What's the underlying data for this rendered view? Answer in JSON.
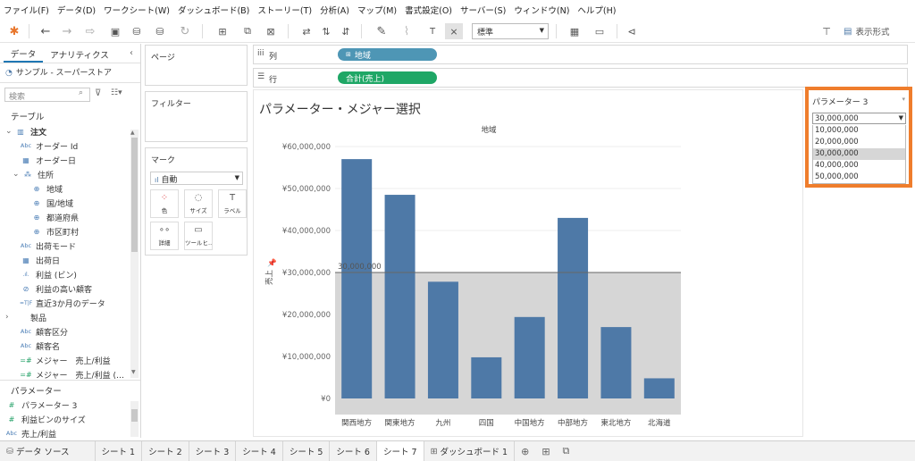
{
  "menu": [
    "ファイル(F)",
    "データ(D)",
    "ワークシート(W)",
    "ダッシュボード(B)",
    "ストーリー(T)",
    "分析(A)",
    "マップ(M)",
    "書式設定(O)",
    "サーバー(S)",
    "ウィンドウ(N)",
    "ヘルプ(H)"
  ],
  "toolbar": {
    "fit_value": "標準",
    "show_me_label": "表示形式"
  },
  "leftpane": {
    "tabs": [
      "データ",
      "アナリティクス"
    ],
    "datasource": "サンプル - スーパーストア",
    "search_placeholder": "検索",
    "table_heading": "テーブル",
    "fields": [
      {
        "label": "注文",
        "icon": "table-icon",
        "indent": 0
      },
      {
        "label": "オーダー Id",
        "icon": "abc-icon",
        "indent": 1
      },
      {
        "label": "オーダー日",
        "icon": "calendar-icon",
        "indent": 1
      },
      {
        "label": "住所",
        "icon": "hierarchy-icon",
        "indent": 1
      },
      {
        "label": "地域",
        "icon": "globe-icon",
        "indent": 2
      },
      {
        "label": "国/地域",
        "icon": "globe-icon",
        "indent": 2
      },
      {
        "label": "都道府県",
        "icon": "globe-icon",
        "indent": 2
      },
      {
        "label": "市区町村",
        "icon": "globe-icon",
        "indent": 2
      },
      {
        "label": "出荷モード",
        "icon": "abc-icon",
        "indent": 1
      },
      {
        "label": "出荷日",
        "icon": "calendar-icon",
        "indent": 1
      },
      {
        "label": "利益 (ビン)",
        "icon": "bin-icon",
        "indent": 1
      },
      {
        "label": "利益の高い顧客",
        "icon": "set-icon",
        "indent": 1
      },
      {
        "label": "直近3か月のデータ",
        "icon": "calc-icon",
        "indent": 1
      },
      {
        "label": "製品",
        "icon": "folder-icon",
        "indent": 0
      },
      {
        "label": "顧客区分",
        "icon": "abc-icon",
        "indent": 1
      },
      {
        "label": "顧客名",
        "icon": "abc-icon",
        "indent": 1
      },
      {
        "label": "メジャー　売上/利益",
        "icon": "calc-green-icon",
        "indent": 1
      },
      {
        "label": "メジャー　売上/利益 (…",
        "icon": "calc-green-icon",
        "indent": 1
      }
    ],
    "params_heading": "パラメーター",
    "params": [
      {
        "label": "パラメーター 3",
        "icon": "hash-icon"
      },
      {
        "label": "利益ビンのサイズ",
        "icon": "hash-icon"
      },
      {
        "label": "売上/利益",
        "icon": "abc-icon"
      }
    ]
  },
  "shelves": {
    "pages": "ページ",
    "filters": "フィルター",
    "marks": "マーク",
    "marks_type": "自動",
    "mark_buttons": [
      "色",
      "サイズ",
      "ラベル",
      "詳細",
      "ツールヒ..."
    ],
    "columns_label": "列",
    "rows_label": "行",
    "columns_pill": "地域",
    "rows_pill": "合計(売上)"
  },
  "chart_data": {
    "type": "bar",
    "title": "パラメーター・メジャー選択",
    "header": "地域",
    "ylabel": "売上",
    "categories": [
      "関西地方",
      "関東地方",
      "九州",
      "四国",
      "中国地方",
      "中部地方",
      "東北地方",
      "北海道"
    ],
    "values": [
      57000000,
      48500000,
      27800000,
      9800000,
      19400000,
      43000000,
      17000000,
      4800000
    ],
    "ylim": [
      0,
      60000000
    ],
    "yticks": [
      "¥60,000,000",
      "¥50,000,000",
      "¥40,000,000",
      "¥30,000,000",
      "¥20,000,000",
      "¥10,000,000",
      "¥0"
    ],
    "yticks_values": [
      60000000,
      50000000,
      40000000,
      30000000,
      20000000,
      10000000,
      0
    ],
    "reference_line": {
      "value": 30000000,
      "label": "30,000,000"
    },
    "bar_color": "#4e79a7",
    "band_color": "#d6d6d6"
  },
  "parameter_card": {
    "title": "パラメーター 3",
    "selected": "30,000,000",
    "options": [
      "10,000,000",
      "20,000,000",
      "30,000,000",
      "40,000,000",
      "50,000,000"
    ],
    "highlight_color": "#ef7d2c"
  },
  "bottom_tabs": [
    "データ ソース",
    "シート 1",
    "シート 2",
    "シート 3",
    "シート 4",
    "シート 5",
    "シート 6",
    "シート 7",
    "ダッシュボード 1"
  ],
  "active_tab": "シート 7"
}
